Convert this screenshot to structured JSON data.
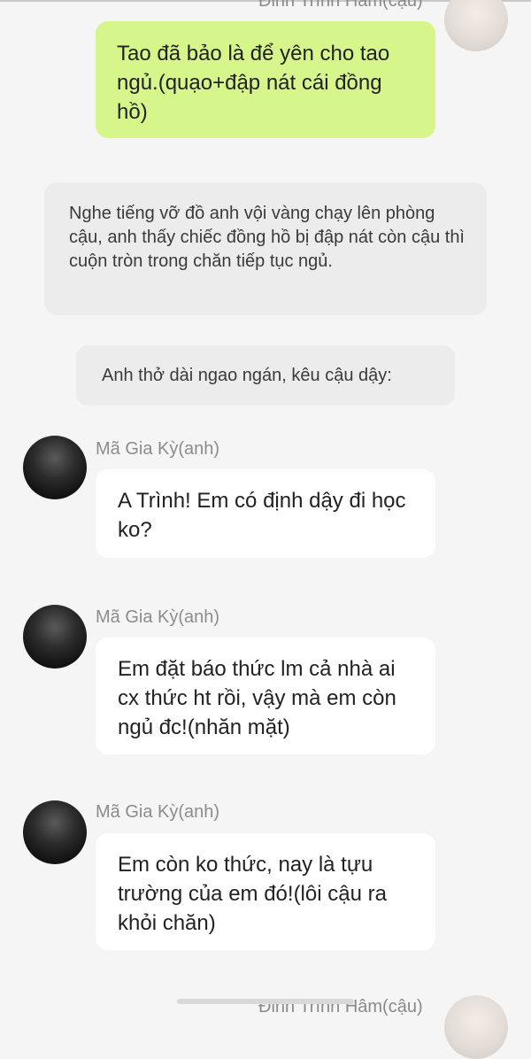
{
  "header_name": "Đinh Trình Hâm(cậu)",
  "messages": {
    "m1": "Tao đã bảo là để yên cho tao ngủ.(quạo+đập nát cái đồng hồ)",
    "n1": "Nghe tiếng vỡ đồ anh vội vàng chạy lên phòng cậu, anh thấy chiếc đồng hồ bị đập nát còn cậu thì cuộn tròn trong chăn tiếp tục ngủ.",
    "n2": "Anh thở dài ngao ngán, kêu cậu dậy:",
    "m2": "A Trình! Em có định dậy đi học ko?",
    "m3": "Em đặt báo thức lm cả nhà ai cx thức ht rồi, vậy mà em còn ngủ đc!(nhăn mặt)",
    "m4": "Em còn ko thức, nay là tựu trường của em đó!(lôi cậu ra khỏi chăn)"
  },
  "sender_name": "Mã Gia Kỳ(anh)",
  "footer_name": "Đinh Trình Hâm(cậu)"
}
